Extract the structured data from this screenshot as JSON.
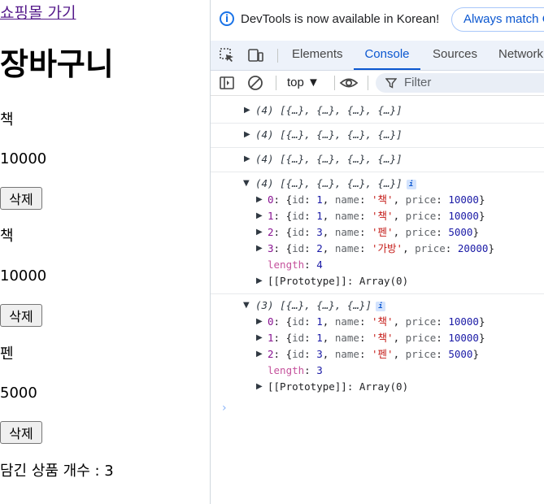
{
  "page": {
    "shop_link": "쇼핑몰 가기",
    "heading": "장바구니",
    "items": [
      {
        "name": "책",
        "price": "10000",
        "delete_label": "삭제"
      },
      {
        "name": "책",
        "price": "10000",
        "delete_label": "삭제"
      },
      {
        "name": "펜",
        "price": "5000",
        "delete_label": "삭제"
      }
    ],
    "count_text": "담긴 상품 개수 : 3"
  },
  "devtools": {
    "infobar": {
      "message": "DevTools is now available in Korean!",
      "button": "Always match C"
    },
    "tabs": [
      "Elements",
      "Console",
      "Sources",
      "Network"
    ],
    "active_tab": "Console",
    "toolbar": {
      "context": "top ▼",
      "filter_placeholder": "Filter"
    },
    "console": {
      "collapsed_summary": "(4) [{…}, {…}, {…}, {…}]",
      "expanded_4": {
        "summary": "(4) [{…}, {…}, {…}, {…}]",
        "items": [
          {
            "index": "0",
            "id": "1",
            "name": "'책'",
            "price": "10000"
          },
          {
            "index": "1",
            "id": "1",
            "name": "'책'",
            "price": "10000"
          },
          {
            "index": "2",
            "id": "3",
            "name": "'펜'",
            "price": "5000"
          },
          {
            "index": "3",
            "id": "2",
            "name": "'가방'",
            "price": "20000"
          }
        ],
        "length": "4",
        "prototype": "[[Prototype]]: Array(0)"
      },
      "expanded_3": {
        "summary": "(3) [{…}, {…}, {…}]",
        "items": [
          {
            "index": "0",
            "id": "1",
            "name": "'책'",
            "price": "10000"
          },
          {
            "index": "1",
            "id": "1",
            "name": "'책'",
            "price": "10000"
          },
          {
            "index": "2",
            "id": "3",
            "name": "'펜'",
            "price": "5000"
          }
        ],
        "length": "3",
        "prototype": "[[Prototype]]: Array(0)"
      },
      "labels": {
        "length": "length",
        "id": "id",
        "name": "name",
        "price": "price",
        "badge": "i"
      }
    },
    "colors": {
      "accent": "#0b57d0",
      "tabbar_bg": "#edf2fa"
    }
  }
}
